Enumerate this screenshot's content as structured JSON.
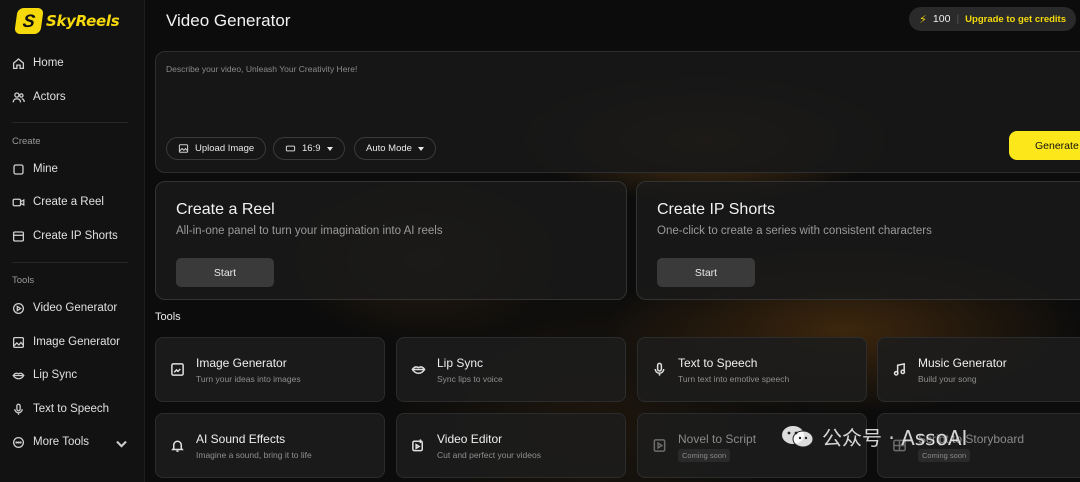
{
  "logo": {
    "text": "SkyReels"
  },
  "sidebar": {
    "items": [
      {
        "label": "Home",
        "icon": "home-icon"
      },
      {
        "label": "Actors",
        "icon": "users-icon"
      }
    ],
    "sections": [
      {
        "title": "Create",
        "items": [
          {
            "label": "Mine",
            "icon": "square-icon"
          },
          {
            "label": "Create a Reel",
            "icon": "video-icon"
          },
          {
            "label": "Create IP Shorts",
            "icon": "panel-icon"
          }
        ]
      },
      {
        "title": "Tools",
        "items": [
          {
            "label": "Video Generator",
            "icon": "play-circle-icon"
          },
          {
            "label": "Image Generator",
            "icon": "image-icon"
          },
          {
            "label": "Lip Sync",
            "icon": "lips-icon"
          },
          {
            "label": "Text to Speech",
            "icon": "microphone-icon"
          },
          {
            "label": "More Tools",
            "icon": "more-circle-icon"
          }
        ]
      }
    ]
  },
  "header": {
    "title": "Video Generator",
    "credits": "100",
    "upgrade_label": "Upgrade to get credits"
  },
  "prompt": {
    "placeholder": "Describe your video, Unleash Your Creativity Here!",
    "upload_label": "Upload Image",
    "ratio_label": "16:9",
    "mode_label": "Auto Mode",
    "generate_label": "Generate"
  },
  "hero_cards": [
    {
      "title": "Create a Reel",
      "desc": "All-in-one panel to turn your imagination into AI reels",
      "button": "Start"
    },
    {
      "title": "Create IP Shorts",
      "desc": "One-click to create a series with consistent characters",
      "button": "Start"
    }
  ],
  "tools": {
    "label": "Tools",
    "items": [
      {
        "name": "Image Generator",
        "desc": "Turn your ideas into images",
        "icon": "image-icon"
      },
      {
        "name": "Lip Sync",
        "desc": "Sync lips to voice",
        "icon": "lips-icon"
      },
      {
        "name": "Text to Speech",
        "desc": "Turn text into emotive speech",
        "icon": "microphone-icon"
      },
      {
        "name": "Music Generator",
        "desc": "Build your song",
        "icon": "music-note-icon"
      },
      {
        "name": "AI Sound Effects",
        "desc": "Imagine a sound, bring it to life",
        "icon": "bell-icon"
      },
      {
        "name": "Video Editor",
        "desc": "Cut and perfect your videos",
        "icon": "video-edit-icon"
      },
      {
        "name": "Novel to Script",
        "badge": "Coming soon",
        "icon": "play-doc-icon"
      },
      {
        "name": "Script to Storyboard",
        "badge": "Coming soon",
        "icon": "storyboard-icon"
      }
    ]
  },
  "watermark": {
    "text": "公众号 · AssoAI"
  },
  "colors": {
    "accent": "#fce81a",
    "background": "#0c0c0c",
    "sidebar": "#121212"
  }
}
